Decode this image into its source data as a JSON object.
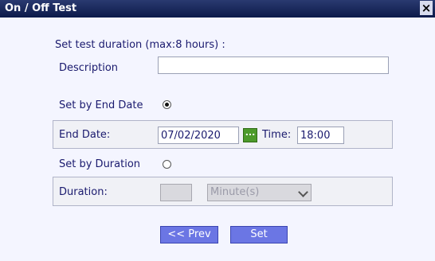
{
  "window": {
    "title": "On / Off Test",
    "close_label": "×"
  },
  "form": {
    "heading": "Set test duration (max:8 hours) :",
    "description_label": "Description",
    "description_value": "",
    "end_date_option_label": "Set by End Date",
    "end_date_option_selected": true,
    "end_date_label": "End Date:",
    "end_date_value": "07/02/2020",
    "date_picker_label": "...",
    "time_label": "Time:",
    "time_value": "18:00",
    "duration_option_label": "Set by Duration",
    "duration_option_selected": false,
    "duration_label": "Duration:",
    "duration_value": "",
    "duration_unit": "Minute(s)"
  },
  "buttons": {
    "prev_label": "<< Prev",
    "set_label": "Set"
  },
  "colors": {
    "titlebar": "#0c1a4a",
    "background": "#f4f5ff",
    "text": "#1a1a6e",
    "button": "#6b76e4",
    "picker": "#4c9a2a"
  }
}
